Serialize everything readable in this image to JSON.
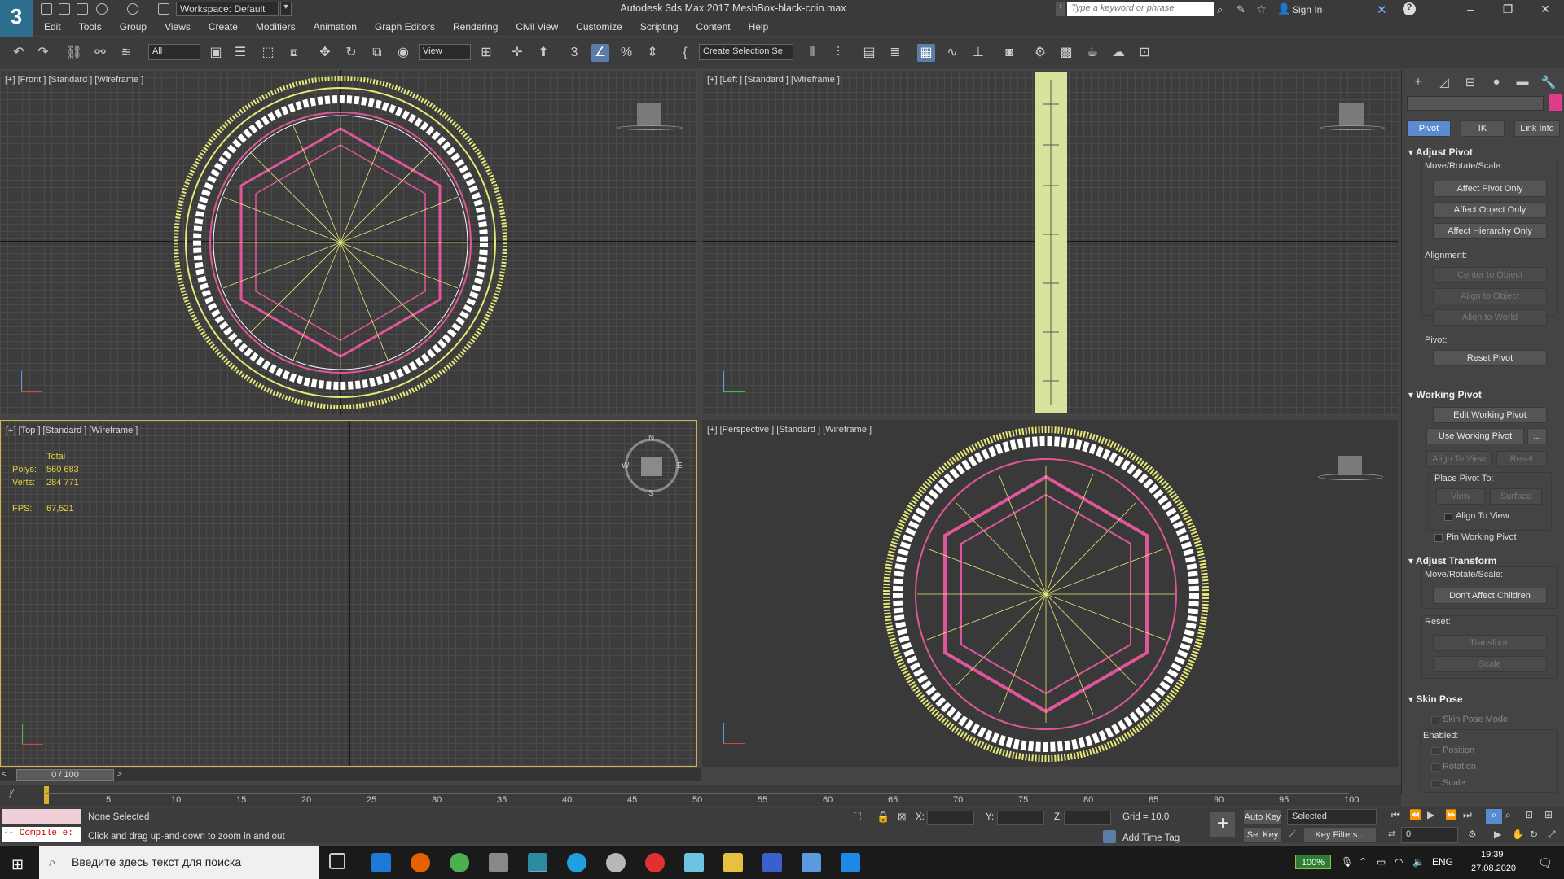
{
  "app": {
    "logo": "3",
    "workspace": "Workspace: Default",
    "title": "Autodesk 3ds Max 2017     MeshBox-black-coin.max",
    "search_placeholder": "Type a keyword or phrase",
    "sign_in": "Sign In"
  },
  "menu": [
    "Edit",
    "Tools",
    "Group",
    "Views",
    "Create",
    "Modifiers",
    "Animation",
    "Graph Editors",
    "Rendering",
    "Civil View",
    "Customize",
    "Scripting",
    "Content",
    "Help"
  ],
  "toolbar": {
    "filter": "All",
    "ref_coord": "View",
    "selection_set": "Create Selection Se"
  },
  "viewports": {
    "front": {
      "label": "[+] [Front ] [Standard ] [Wireframe ]"
    },
    "left": {
      "label": "[+] [Left ] [Standard ] [Wireframe ]"
    },
    "top": {
      "label": "[+] [Top ] [Standard ] [Wireframe ]",
      "stats": {
        "total_label": "Total",
        "polys_label": "Polys:",
        "polys_value": "560 683",
        "verts_label": "Verts:",
        "verts_value": "284 771",
        "fps_label": "FPS:",
        "fps_value": "67,521"
      },
      "compass": {
        "n": "N",
        "s": "S",
        "w": "W",
        "e": "E"
      }
    },
    "perspective": {
      "label": "[+] [Perspective ] [Standard ] [Wireframe ]"
    }
  },
  "command_panel": {
    "tabs": {
      "pivot": "Pivot",
      "ik": "IK",
      "link_info": "Link Info"
    },
    "adjust_pivot": {
      "title": "Adjust Pivot",
      "move_rotate_scale": "Move/Rotate/Scale:",
      "affect_pivot_only": "Affect Pivot Only",
      "affect_object_only": "Affect Object Only",
      "affect_hierarchy_only": "Affect Hierarchy Only",
      "alignment": "Alignment:",
      "center_to_object": "Center to Object",
      "align_to_object": "Align to Object",
      "align_to_world": "Align to World",
      "pivot": "Pivot:",
      "reset_pivot": "Reset Pivot"
    },
    "working_pivot": {
      "title": "Working Pivot",
      "edit_working_pivot": "Edit Working Pivot",
      "use_working_pivot": "Use Working Pivot",
      "more": "...",
      "align_to_view": "Align To View",
      "reset": "Reset",
      "place_pivot_to": "Place Pivot To:",
      "view": "View",
      "surface": "Surface",
      "align_to_view_check": "Align To View",
      "pin_working_pivot": "Pin Working Pivot"
    },
    "adjust_transform": {
      "title": "Adjust Transform",
      "move_rotate_scale": "Move/Rotate/Scale:",
      "dont_affect_children": "Don't Affect Children",
      "reset": "Reset:",
      "transform": "Transform",
      "scale": "Scale"
    },
    "skin_pose": {
      "title": "Skin Pose",
      "skin_pose_mode": "Skin Pose Mode",
      "enabled": "Enabled:",
      "position": "Position",
      "rotation": "Rotation",
      "scale": "Scale"
    }
  },
  "timeline": {
    "frame": "0 / 100",
    "ticks": [
      "5",
      "10",
      "15",
      "20",
      "25",
      "30",
      "35",
      "40",
      "45",
      "50",
      "55",
      "60",
      "65",
      "70",
      "75",
      "80",
      "85",
      "90",
      "95",
      "100"
    ]
  },
  "status": {
    "maxscript": "-- Compile e:",
    "selection": "None Selected",
    "prompt": "Click and drag up-and-down to zoom in and out",
    "x_label": "X:",
    "y_label": "Y:",
    "z_label": "Z:",
    "grid": "Grid = 10,0",
    "add_time_tag": "Add Time Tag",
    "auto_key": "Auto Key",
    "selected": "Selected",
    "set_key": "Set Key",
    "key_filters": "Key Filters...",
    "frame_value": "0"
  },
  "taskbar": {
    "search_placeholder": "Введите здесь текст для поиска",
    "battery": "100%",
    "lang": "ENG",
    "time": "19:39",
    "date": "27.08.2020"
  },
  "colors": {
    "wire_yellow": "#e6e87a",
    "wire_pink": "#e0569a",
    "active_blue": "#5a8ad0"
  }
}
